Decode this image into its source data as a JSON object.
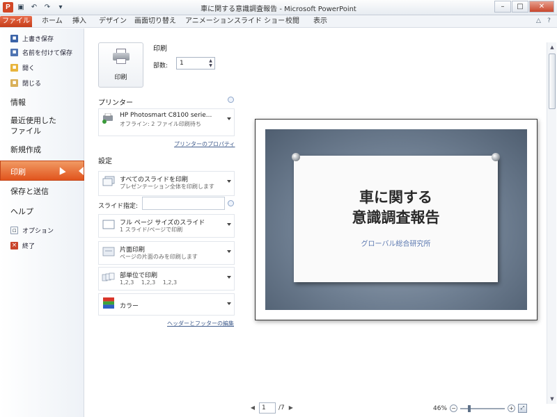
{
  "window": {
    "title": "車に関する意識調査報告 - Microsoft PowerPoint",
    "app_icon": "P",
    "quick_access": [
      "save-icon",
      "undo-icon",
      "redo-icon",
      "customize-icon"
    ],
    "controls": [
      "minimize",
      "maximize",
      "close"
    ]
  },
  "ribbon": {
    "tabs": [
      "ファイル",
      "ホーム",
      "挿入",
      "デザイン",
      "画面切り替え",
      "アニメーション",
      "スライド ショー",
      "校閲",
      "表示"
    ],
    "accent": "#d24726"
  },
  "nav": {
    "small_items": [
      "上書き保存",
      "名前を付けて保存",
      "開く",
      "閉じる"
    ],
    "info": "情報",
    "recent": "最近使用した\nファイル",
    "new": "新規作成",
    "print": "印刷",
    "save_send": "保存と送信",
    "help": "ヘルプ",
    "options": "オプション",
    "exit": "終了"
  },
  "settings": {
    "print_button": "印刷",
    "print_title": "印刷",
    "copies_label": "部数:",
    "copies_value": "1",
    "printer_title": "プリンター",
    "printer_name": "HP Photosmart C8100 serie...",
    "printer_status": "オフライン: 2 ファイル印刷待ち",
    "printer_properties": "プリンターのプロパティ",
    "settings_title": "設定",
    "range_main": "すべてのスライドを印刷",
    "range_sub": "プレゼンテーション全体を印刷します",
    "slides_label": "スライド指定:",
    "slides_value": "",
    "layout_main": "フル ページ サイズのスライド",
    "layout_sub": "1 スライド/ページで印刷",
    "sides_main": "片面印刷",
    "sides_sub": "ページの片面のみを印刷します",
    "collate_main": "部単位で印刷",
    "collate_sub": "1,2,3　 1,2,3　 1,2,3",
    "color_main": "カラー",
    "header_footer_link": "ヘッダーとフッターの編集"
  },
  "preview": {
    "slide_title": "車に関する\n意識調査報告",
    "slide_subtitle": "グローバル総合研究所",
    "current_page": "1",
    "total_pages": "/7",
    "zoom_level": "46%",
    "zoom_fraction": 0.46
  }
}
